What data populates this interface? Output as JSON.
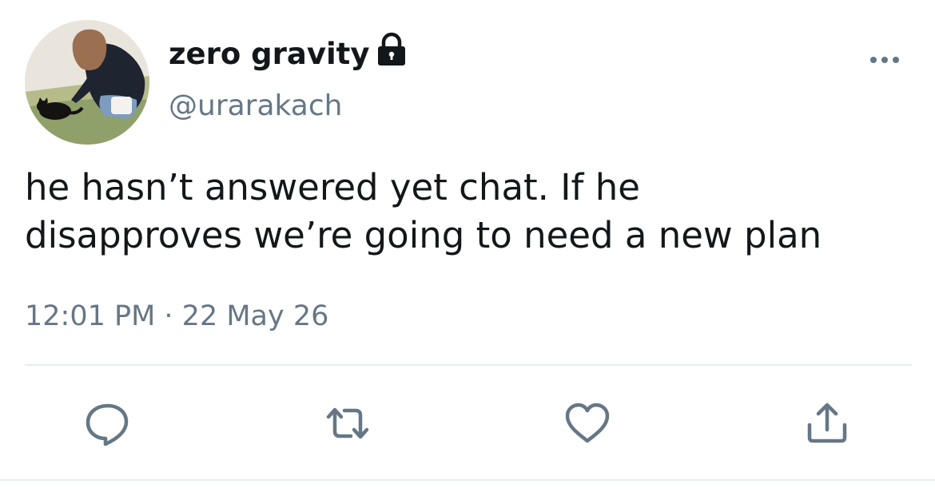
{
  "tweet": {
    "display_name": "zero gravity",
    "handle": "@urarakach",
    "text": "he hasn’t answered yet chat. If he\ndisapproves we’re going to need a new plan",
    "timestamp": "12:01 PM · 22 May 26",
    "protected_icon": "lock-icon",
    "avatar": "avatar-photo"
  },
  "actions": [
    {
      "name": "reply",
      "icon": "reply-icon"
    },
    {
      "name": "retweet",
      "icon": "retweet-icon"
    },
    {
      "name": "like",
      "icon": "heart-icon"
    },
    {
      "name": "share",
      "icon": "share-icon"
    }
  ],
  "colors": {
    "text_primary": "#14171a",
    "text_secondary": "#657786",
    "icon": "#657786",
    "divider": "#e6ecf0",
    "background": "#ffffff"
  }
}
